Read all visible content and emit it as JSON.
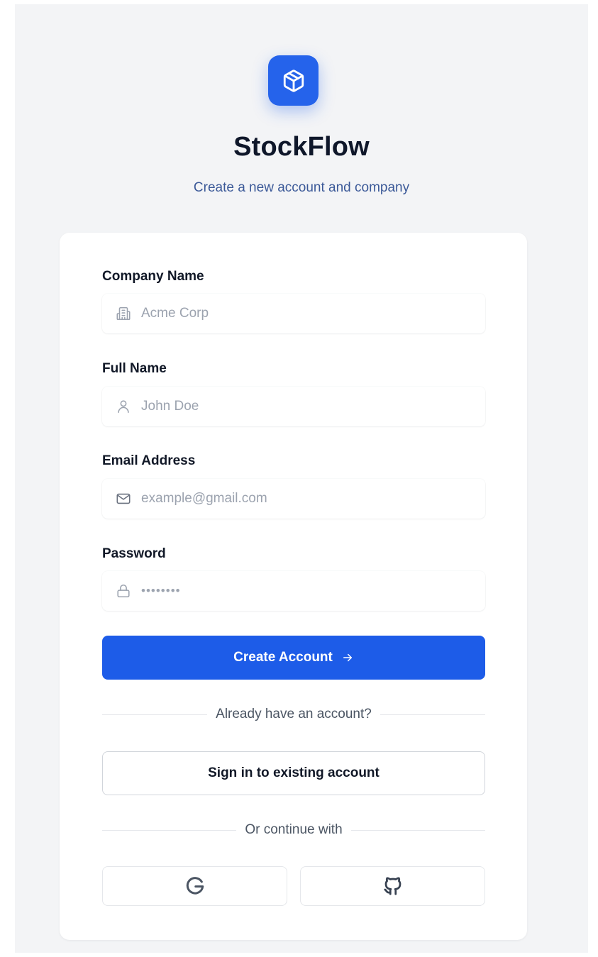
{
  "brand": {
    "name": "StockFlow",
    "subtitle": "Create a new account and company",
    "logo_icon": "package-box-icon",
    "accent_color": "#2563eb"
  },
  "form": {
    "fields": [
      {
        "label": "Company Name",
        "placeholder": "Acme Corp",
        "icon": "building-icon"
      },
      {
        "label": "Full Name",
        "placeholder": "John Doe",
        "icon": "user-icon"
      },
      {
        "label": "Email Address",
        "placeholder": "example@gmail.com",
        "icon": "mail-icon"
      },
      {
        "label": "Password",
        "placeholder": "••••••••",
        "icon": "lock-icon"
      }
    ],
    "submit_label": "Create Account",
    "submit_icon": "arrow-right-icon"
  },
  "signin": {
    "divider_text": "Already have an account?",
    "button_label": "Sign in to existing account"
  },
  "social": {
    "divider_text": "Or continue with",
    "providers": [
      {
        "icon": "google-icon"
      },
      {
        "icon": "github-icon"
      }
    ]
  }
}
